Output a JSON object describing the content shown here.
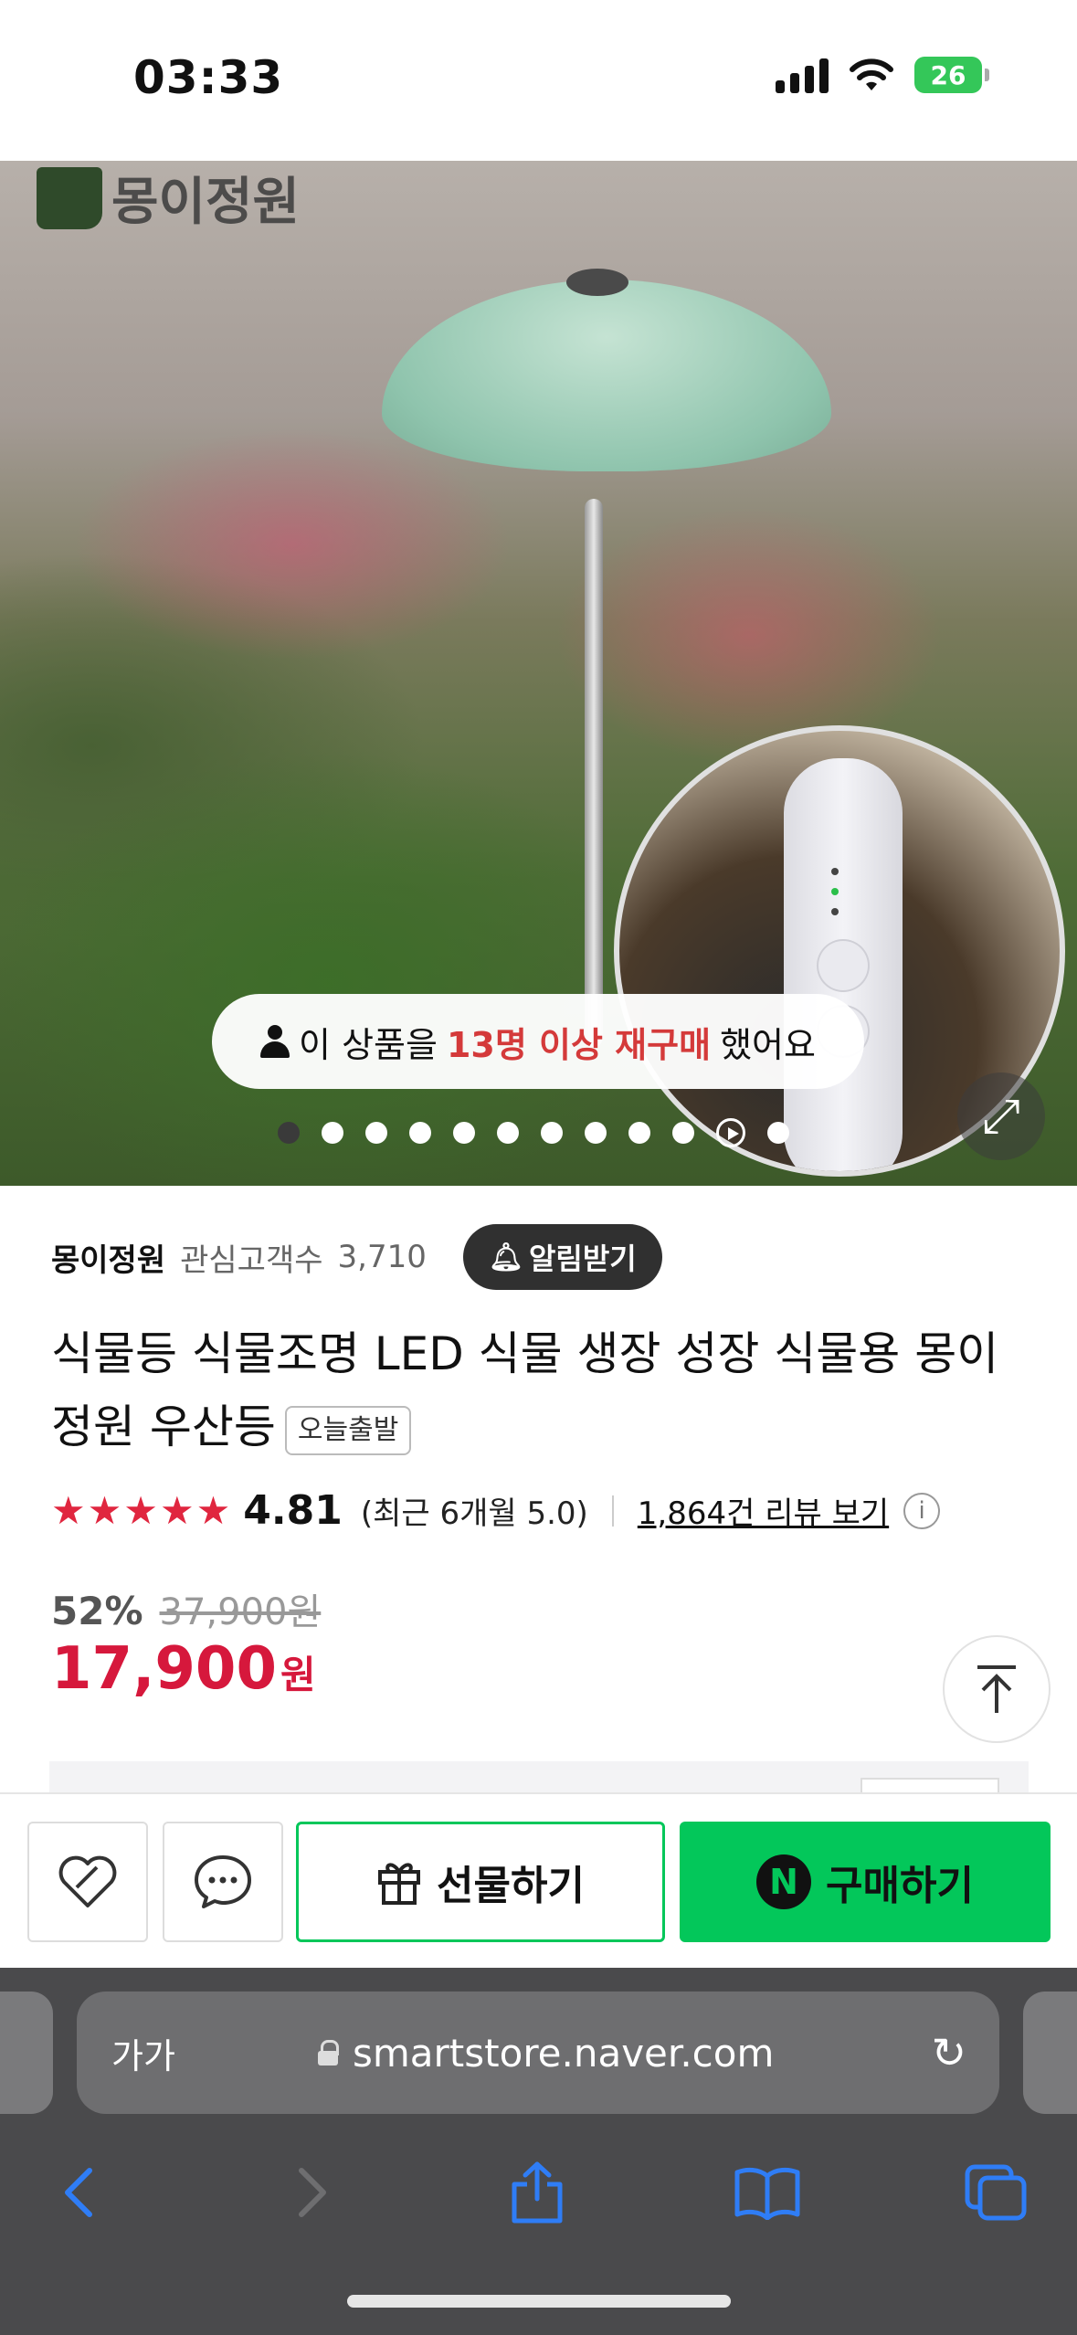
{
  "status_bar": {
    "time": "03:33",
    "battery": "26",
    "battery_color": "#34c759"
  },
  "hero": {
    "brand_logo": "몽이정원",
    "rebuy": {
      "prefix": "이 상품을",
      "highlight": "13명 이상 재구매",
      "suffix": "했어요"
    },
    "slides": {
      "total": 12,
      "active_index": 0,
      "has_video": true
    }
  },
  "store": {
    "name": "몽이정원",
    "follower_label": "관심고객수",
    "follower_count": "3,710",
    "notify_label": "알림받기"
  },
  "product": {
    "title": "식물등 식물조명 LED 식물 생장 성장 식물용 몽이정원 우산등",
    "badge": "오늘출발"
  },
  "rating": {
    "stars": "★★★★★",
    "score": "4.81",
    "recent": "(최근 6개월 5.0)",
    "review_link": "1,864건 리뷰 보기",
    "info": "i"
  },
  "price": {
    "discount": "52%",
    "original": "37,900원",
    "sale": "17,900",
    "unit": "원",
    "accent": "#d6183c"
  },
  "actions": {
    "wish_icon": "heart-tag-icon",
    "talk_icon": "chat-bubble-icon",
    "gift_label": "선물하기",
    "buy_label": "구매하기",
    "naver_n": "N",
    "brand_green": "#03c75a"
  },
  "browser": {
    "aa": "가가",
    "url": "smartstore.naver.com"
  }
}
